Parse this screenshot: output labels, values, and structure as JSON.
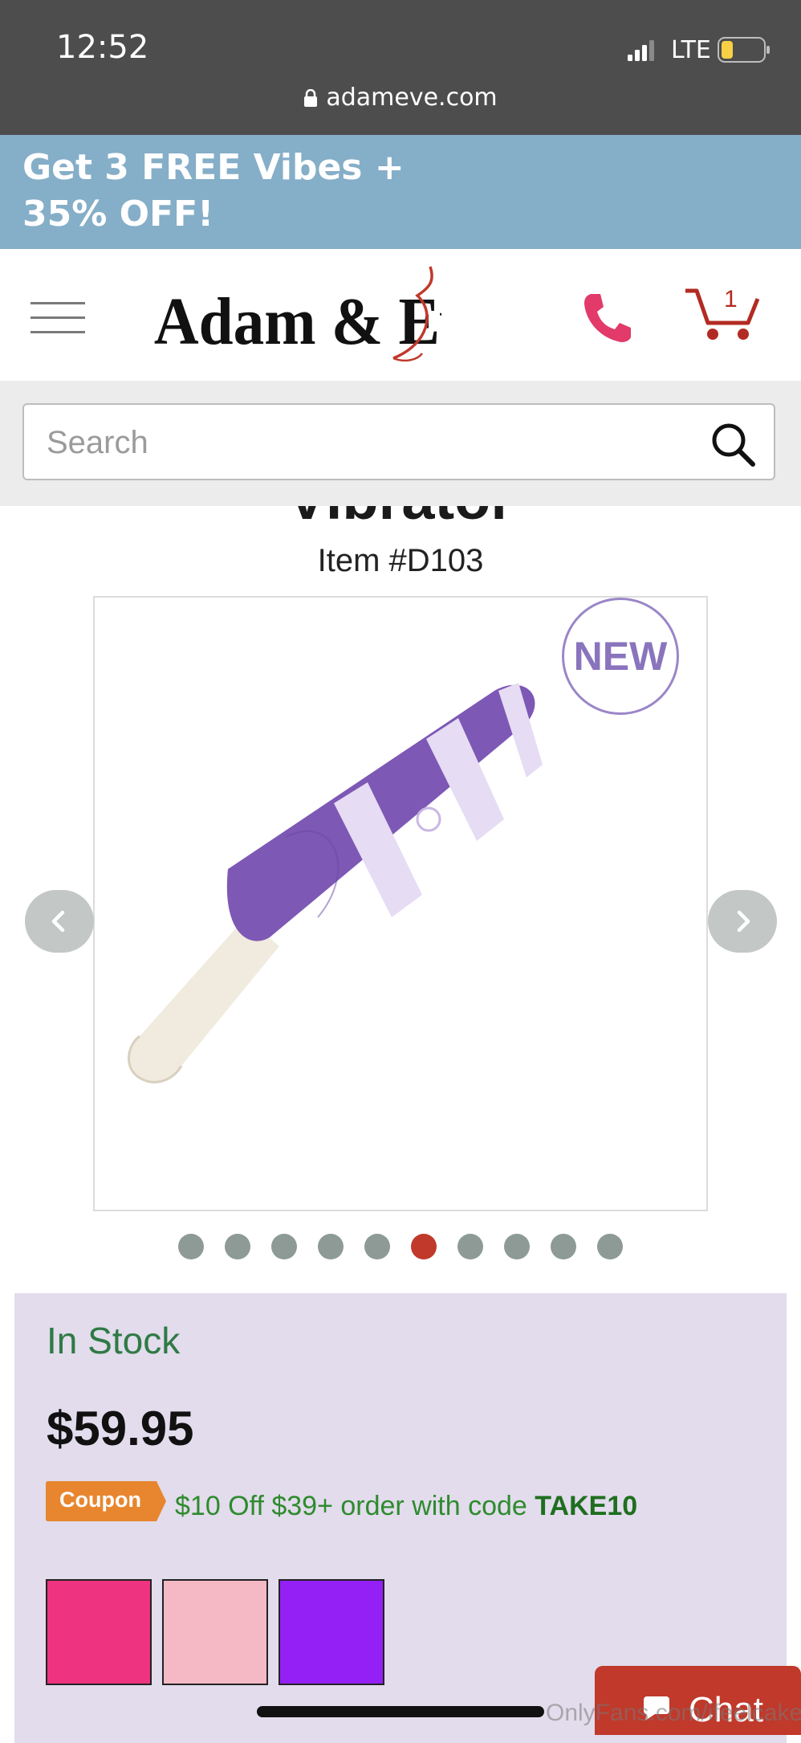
{
  "status_bar": {
    "time": "12:52",
    "network": "LTE",
    "url": "adameve.com"
  },
  "promo_banner": {
    "text": "Get 3 FREE Vibes + 35% OFF!"
  },
  "header": {
    "logo_text": "Adam & Eve",
    "cart_count": "1"
  },
  "search": {
    "placeholder": "Search"
  },
  "product": {
    "title_fragment": "Vibrator",
    "item_number": "Item #D103",
    "badge": "NEW",
    "image_count": 10,
    "active_image_index": 5
  },
  "purchase": {
    "stock_status": "In Stock",
    "price": "$59.95",
    "coupon_tag": "Coupon",
    "coupon_prefix": "$10 Off $39+ order with code",
    "coupon_code": "TAKE10",
    "swatches": [
      "#ee3380",
      "#f4b9c4",
      "#9420f5"
    ]
  },
  "chat": {
    "label": "Chat"
  },
  "watermark": "OnlyFans.com/ifeelcake",
  "colors": {
    "status_bar": "#4d4d4d",
    "promo_banner": "#85aec8",
    "brand_red": "#c0392b",
    "panel_bg": "#e2dcec",
    "stock_green": "#2f7a45"
  }
}
